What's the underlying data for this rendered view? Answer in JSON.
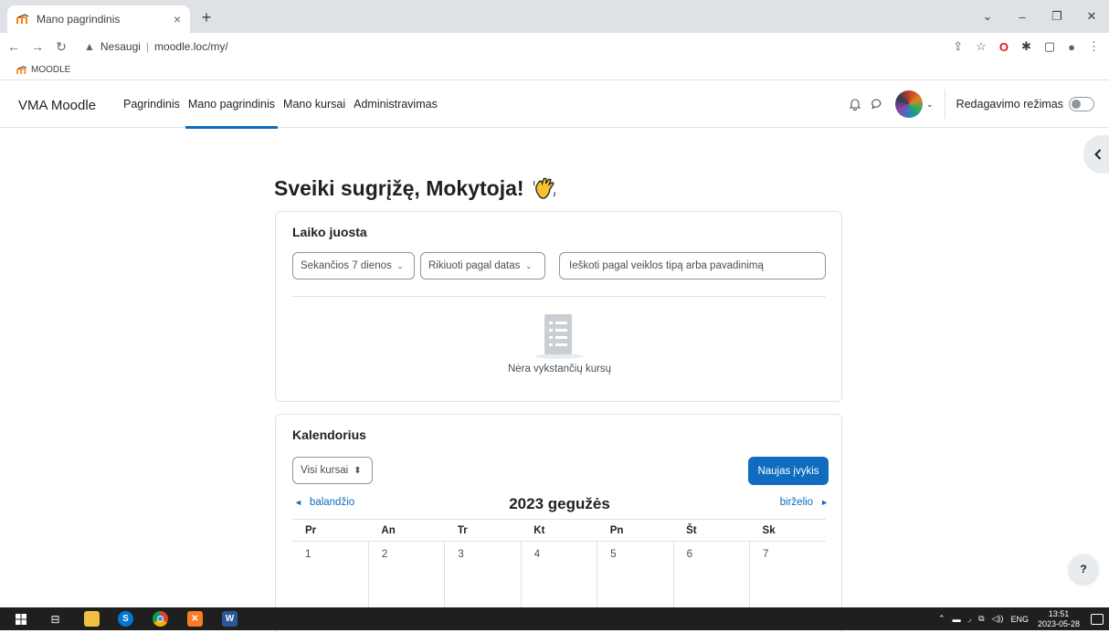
{
  "browser": {
    "tab_title": "Mano pagrindinis",
    "tab_close": "×",
    "new_tab": "+",
    "security_label": "Nesaugi",
    "url": "moodle.loc/my/",
    "bookmark_label": "MOODLE"
  },
  "navbar": {
    "brand": "VMA Moodle",
    "items": [
      {
        "label": "Pagrindinis",
        "active": false
      },
      {
        "label": "Mano pagrindinis",
        "active": true
      },
      {
        "label": "Mano kursai",
        "active": false
      },
      {
        "label": "Administravimas",
        "active": false
      }
    ],
    "edit_mode_label": "Redagavimo režimas",
    "edit_mode_on": false
  },
  "main": {
    "welcome": "Sveiki sugrįžę, Mokytoja!",
    "welcome_emoji": "👋"
  },
  "timeline": {
    "title": "Laiko juosta",
    "filter_days": "Sekančios 7 dienos",
    "sort": "Rikiuoti pagal datas",
    "search_placeholder": "Ieškoti pagal veiklos tipą arba pavadinimą",
    "empty_text": "Nėra vykstančių kursų"
  },
  "calendar": {
    "title": "Kalendorius",
    "course_filter": "Visi kursai",
    "new_event_button": "Naujas įvykis",
    "prev_month": "balandžio",
    "current_month": "2023 gegužės",
    "next_month": "birželio",
    "weekdays": [
      "Pr",
      "An",
      "Tr",
      "Kt",
      "Pn",
      "Št",
      "Sk"
    ],
    "days": [
      "1",
      "2",
      "3",
      "4",
      "5",
      "6",
      "7"
    ]
  },
  "help": "?",
  "taskbar": {
    "language": "ENG",
    "time": "13:51",
    "date": "2023-05-28"
  },
  "colors": {
    "primary": "#0f6cbf",
    "text": "#1d2125",
    "muted": "#495057",
    "border": "#dee2e6"
  }
}
